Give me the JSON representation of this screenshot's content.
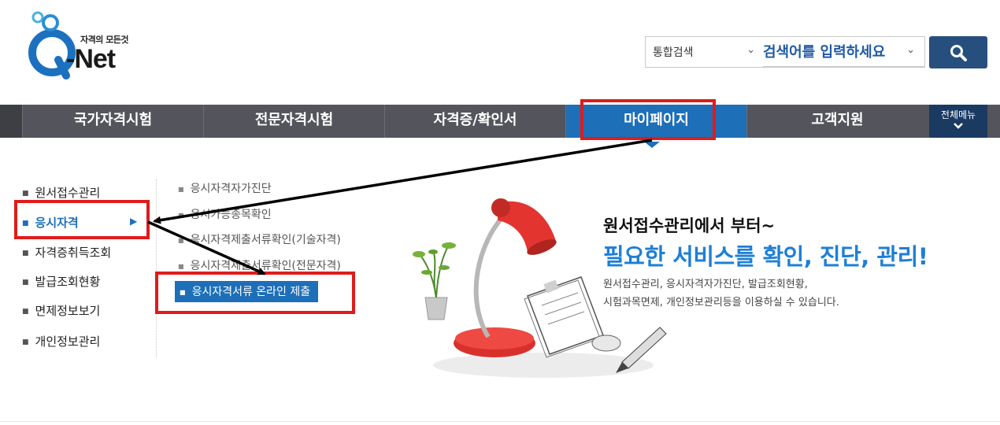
{
  "header": {
    "logo_tagline": "자격의 모든것",
    "logo_name": "-Net",
    "search": {
      "scope_selected": "통합검색",
      "placeholder": "검색어를 입력하세요",
      "button_icon": "search-icon"
    }
  },
  "nav": {
    "items": [
      {
        "label": "국가자격시험"
      },
      {
        "label": "전문자격시험"
      },
      {
        "label": "자격증/확인서"
      },
      {
        "label": "마이페이지"
      },
      {
        "label": "고객지원"
      }
    ],
    "active_index": 3,
    "all_menu_label": "전체메뉴",
    "active_color": "#1d6fb8"
  },
  "left_menu": {
    "items": [
      {
        "label": "원서접수관리"
      },
      {
        "label": "응시자격"
      },
      {
        "label": "자격증취득조회"
      },
      {
        "label": "발급조회현황"
      },
      {
        "label": "면제정보보기"
      },
      {
        "label": "개인정보관리"
      }
    ],
    "selected_index": 1
  },
  "sub_menu": {
    "items": [
      {
        "label": "응시자격자가진단"
      },
      {
        "label": "응시가능종목확인"
      },
      {
        "label": "응시자격제출서류확인(기술자격)"
      },
      {
        "label": "응시자격제출서류확인(전문자격)"
      },
      {
        "label": "응시자격서류 온라인 제출"
      }
    ],
    "selected_index": 4
  },
  "promo": {
    "title_line1": "원서접수관리에서 부터~",
    "title_line2": "필요한 서비스를 확인, 진단, 관리!",
    "desc_line1": "원서접수관리, 응시자격자가진단, 발급조회현황,",
    "desc_line2": "시험과목면제, 개인정보관리등을 이용하실 수 있습니다."
  },
  "annotation_color": "#e01b1b"
}
